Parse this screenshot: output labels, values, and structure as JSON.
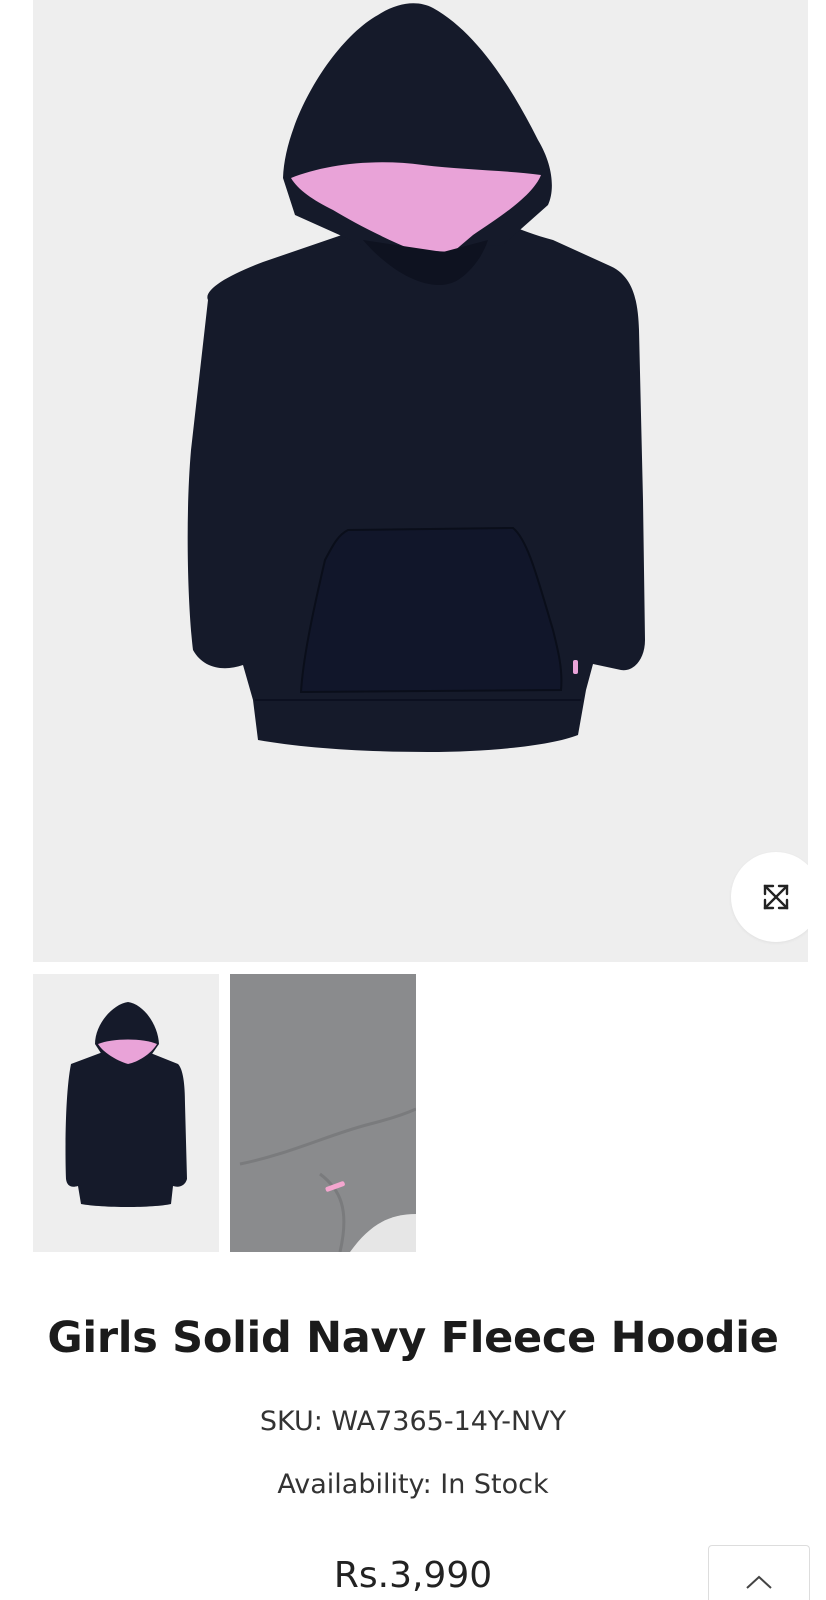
{
  "product": {
    "title": "Girls Solid Navy Fleece Hoodie",
    "sku": "SKU: WA7365-14Y-NVY",
    "availability": "Availability: In Stock",
    "price": "Rs.3,990"
  },
  "gallery": {
    "main_image_alt": "Girls Solid Navy Fleece Hoodie",
    "thumbnails": [
      {
        "alt": "Hoodie front view"
      },
      {
        "alt": "Fabric close-up"
      }
    ],
    "zoom_icon": "expand-icon"
  },
  "scroll_top_icon": "chevron-up-icon",
  "colors": {
    "navy": "#151a2a",
    "pink_lining": "#e9a3d8",
    "image_bg": "#eeeeee",
    "close_up_bg": "#8a8b8d"
  }
}
